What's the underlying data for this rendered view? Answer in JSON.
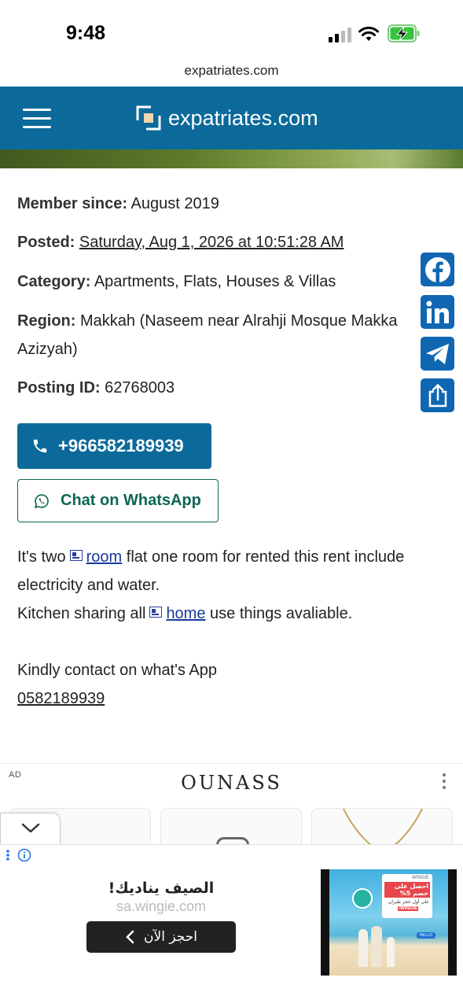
{
  "status_bar": {
    "time": "9:48"
  },
  "browser": {
    "url": "expatriates.com"
  },
  "header": {
    "logo_text": "expatriates.com",
    "color": "#0c6a9a"
  },
  "details": {
    "member_since_label": "Member since:",
    "member_since_value": " August 2019",
    "posted_label": "Posted:",
    "posted_value": "Saturday, Aug 1, 2026 at 10:51:28 AM",
    "category_label": "Category:",
    "category_value": " Apartments, Flats, Houses & Villas",
    "region_label": "Region:",
    "region_value_line1": " Makkah (Naseem near Alrahji Mosque Makka",
    "region_value_line2": "Azizyah)",
    "posting_id_label": "Posting ID:",
    "posting_id_value": " 62768003"
  },
  "actions": {
    "phone_label": "+966582189939",
    "whatsapp_label": "Chat on WhatsApp"
  },
  "description": {
    "l1_a": "It's two",
    "l1_link": "room",
    "l1_b": " flat one room for rented this rent include",
    "l2": "electricity and water.",
    "l3_a": "Kitchen sharing all",
    "l3_link": "home",
    "l3_b": " use things avaliable.",
    "l5": "Kindly contact on what's App",
    "l6": "0582189939"
  },
  "social": [
    {
      "icon": "facebook-icon",
      "color": "#0f67b2"
    },
    {
      "icon": "linkedin-icon",
      "color": "#0f67b2"
    },
    {
      "icon": "telegram-icon",
      "color": "#0f67b2"
    },
    {
      "icon": "share-icon",
      "color": "#0f67b2"
    }
  ],
  "ad": {
    "tag": "AD",
    "brand": "OUNASS"
  },
  "banner": {
    "title": "الصيف يناديك!",
    "domain": "sa.wingie.com",
    "cta": "احجز الآن",
    "promo_line1": "احصل على خصم 5%",
    "promo_line2": "على أول حجز طيران",
    "promo_code": "!WINGIE",
    "brand": "WINGIE",
    "hello": "HELLO"
  }
}
